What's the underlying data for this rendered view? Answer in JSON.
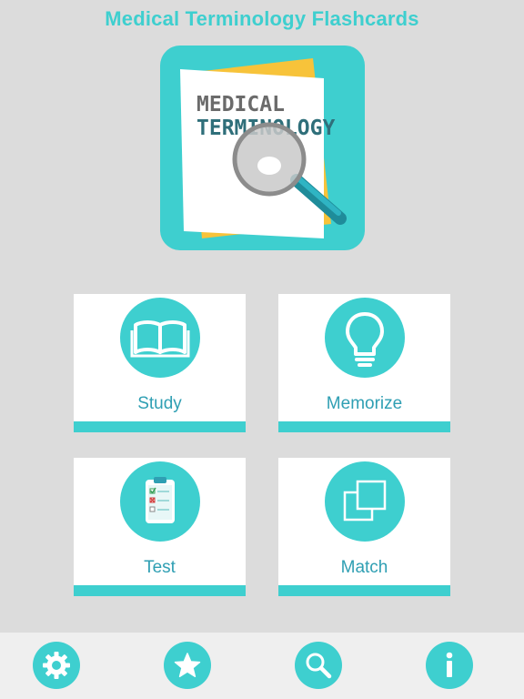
{
  "header": {
    "title": "Medical Terminology Flashcards"
  },
  "logo": {
    "line1": "MEDICAL",
    "line2": "TERMINOLOGY"
  },
  "menu": {
    "study_label": "Study",
    "memorize_label": "Memorize",
    "test_label": "Test",
    "match_label": "Match"
  },
  "icons": {
    "study": "open-book-icon",
    "memorize": "lightbulb-icon",
    "test": "clipboard-checklist-icon",
    "match": "overlapping-squares-icon",
    "settings": "gear-icon",
    "favorites": "star-icon",
    "search": "magnifier-icon",
    "info": "info-icon"
  },
  "colors": {
    "accent": "#3ecfcf",
    "label": "#2f9fb3",
    "background": "#dcdcdc",
    "card": "#ffffff"
  }
}
